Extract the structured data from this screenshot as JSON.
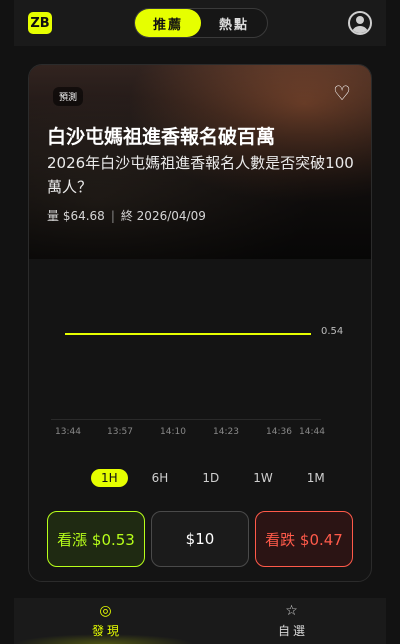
{
  "header": {
    "logo_text": "ZB",
    "tabs": [
      {
        "label": "推薦",
        "active": true
      },
      {
        "label": "熱點",
        "active": false
      }
    ]
  },
  "market_card": {
    "badge": "預測",
    "title": "白沙屯媽祖進香報名破百萬",
    "subtitle": "2026年白沙屯媽祖進香報名人數是否突破100萬人？",
    "volume_label": "量 $64.68",
    "end_label": "終 2026/04/09",
    "chart": {
      "line_label": "0.54",
      "x_ticks": [
        "13:44",
        "13:57",
        "14:10",
        "14:23",
        "14:36",
        "14:44"
      ]
    },
    "ranges": [
      "1H",
      "6H",
      "1D",
      "1W",
      "1M"
    ],
    "active_range": "1H",
    "buttons": {
      "up": "看漲 $0.53",
      "amount": "$10",
      "down": "看跌 $0.47"
    }
  },
  "bottom_nav": [
    {
      "label": "發現",
      "active": true,
      "icon": "compass-icon"
    },
    {
      "label": "自選",
      "active": false,
      "icon": "star-icon"
    }
  ],
  "colors": {
    "accent": "#e6ff00",
    "up": "#b7ff1a",
    "down": "#ff5a4a",
    "background": "#121212"
  }
}
